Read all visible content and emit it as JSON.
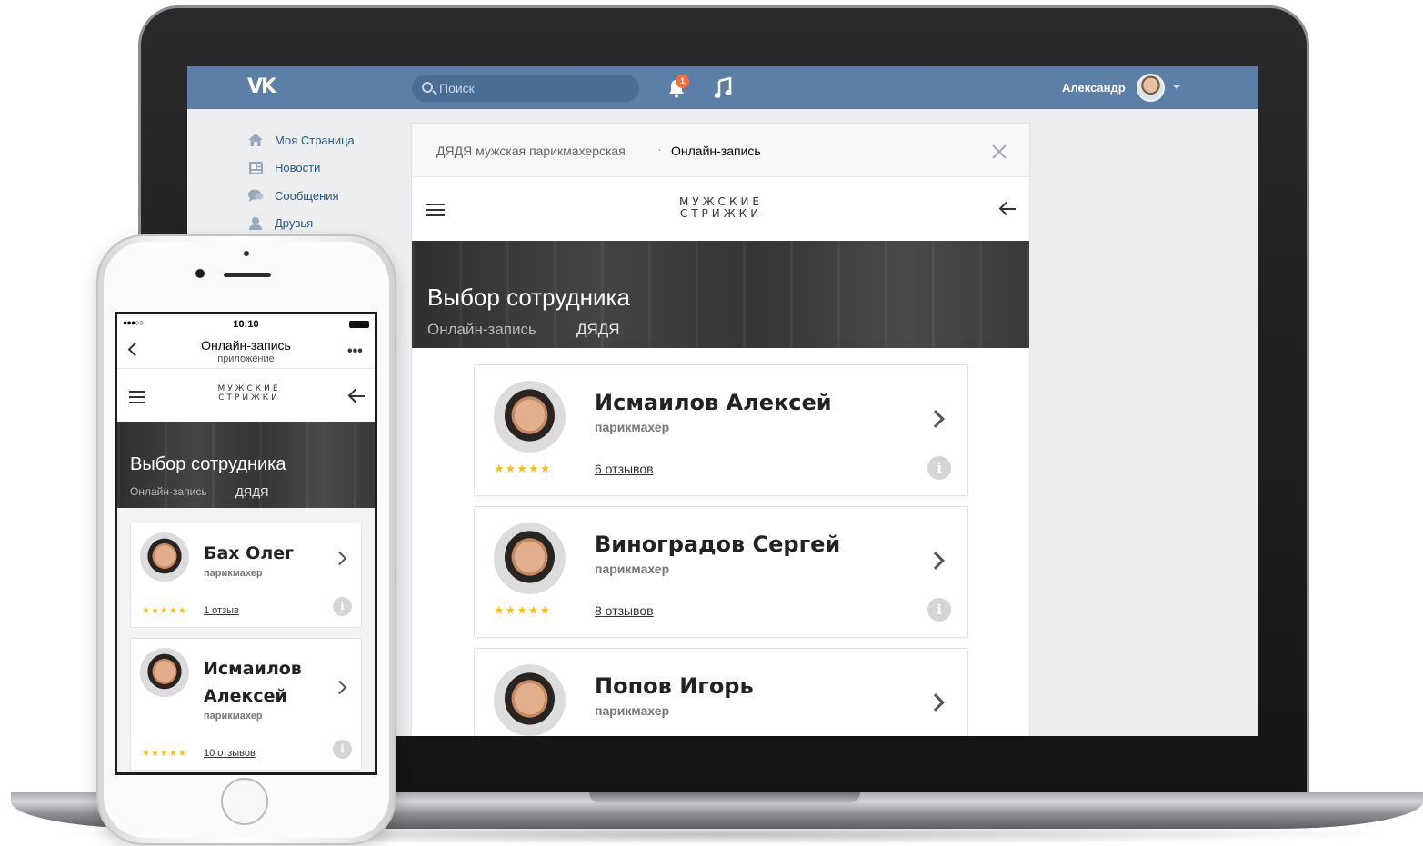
{
  "vk": {
    "logo": "VK",
    "search_placeholder": "Поиск",
    "notifications_count": "1",
    "user_name": "Александр",
    "menu": [
      {
        "label": "Моя Страница"
      },
      {
        "label": "Новости"
      },
      {
        "label": "Сообщения"
      },
      {
        "label": "Друзья"
      }
    ]
  },
  "panel": {
    "breadcrumb_1": "ДЯДЯ мужская парикмахерская",
    "breadcrumb_sep": "·",
    "breadcrumb_2": "Онлайн-запись"
  },
  "app": {
    "brand_line1": "МУЖСКИЕ",
    "brand_line2": "СТРИЖКИ",
    "hero_title": "Выбор сотрудника",
    "hero_sub": "Онлайн-запись",
    "hero_sub2": "ДЯДЯ"
  },
  "desktop_staff": [
    {
      "name": "Исмаилов Алексей",
      "role": "парикмахер",
      "stars": "★★★★★",
      "reviews": "6 отзывов"
    },
    {
      "name": "Виноградов Сергей",
      "role": "парикмахер",
      "stars": "★★★★★",
      "reviews": "8 отзывов"
    },
    {
      "name": "Попов Игорь",
      "role": "парикмахер"
    }
  ],
  "phone": {
    "signal": "●●●○○",
    "time": "10:10",
    "nav_title": "Онлайн-запись",
    "nav_subtitle": "приложение",
    "more": "•••",
    "staff": [
      {
        "name": "Бах Олег",
        "role": "парикмахер",
        "stars": "★★★★★",
        "reviews": "1 отзыв"
      },
      {
        "name": "Исмаилов Алексей",
        "role": "парикмахер",
        "stars": "★★★★★",
        "reviews": "10 отзывов"
      }
    ]
  },
  "colors": {
    "vk_header": "#5b7fa6",
    "vk_link": "#2a5885",
    "star": "#f6c21a",
    "badge": "#ff6b3d"
  }
}
